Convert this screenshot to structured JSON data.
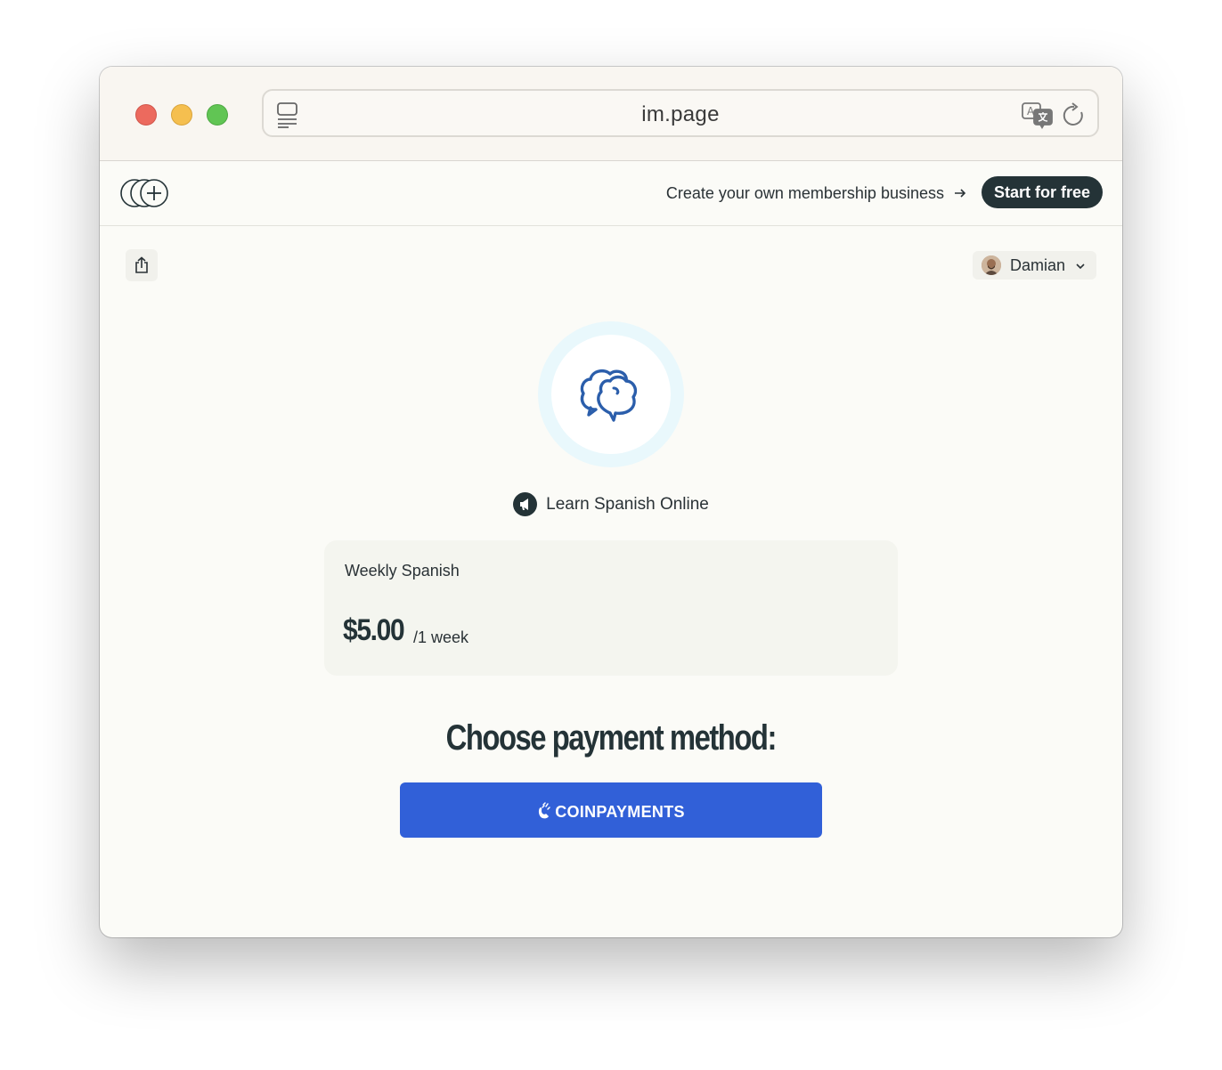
{
  "browser": {
    "url": "im.page"
  },
  "topbar": {
    "promo_text": "Create your own membership business",
    "cta_label": "Start for free"
  },
  "user": {
    "name": "Damian"
  },
  "community": {
    "name": "Learn Spanish Online"
  },
  "plan": {
    "name": "Weekly Spanish",
    "price": "$5.00",
    "period": "/1 week"
  },
  "payment": {
    "heading": "Choose payment method:",
    "provider_label": "COINPAYMENTS"
  },
  "colors": {
    "accent": "#3160d8",
    "dark": "#243337",
    "hero_ring": "#e9f8fc",
    "card_bg": "#f4f5ef"
  },
  "icons": [
    "sidebar-icon",
    "translate-icon",
    "reload-icon",
    "logo-icon",
    "arrow-right-icon",
    "share-icon",
    "chevron-down-icon",
    "chat-bubbles-icon",
    "megaphone-icon",
    "coinpayments-icon"
  ]
}
